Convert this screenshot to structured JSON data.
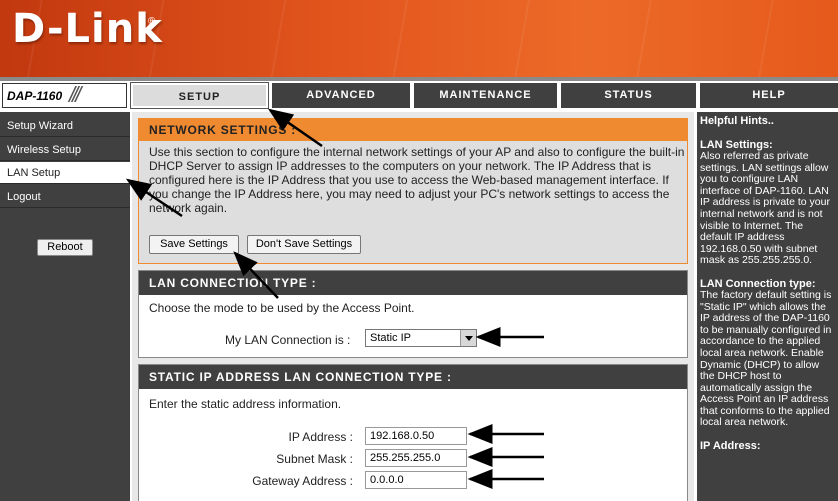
{
  "brand": {
    "logo": "D-Link",
    "registered": "®"
  },
  "model": {
    "label": "DAP-1160",
    "slashes": "///"
  },
  "tabs": [
    {
      "label": "SETUP",
      "active": true
    },
    {
      "label": "ADVANCED",
      "active": false
    },
    {
      "label": "MAINTENANCE",
      "active": false
    },
    {
      "label": "STATUS",
      "active": false
    },
    {
      "label": "HELP",
      "active": false
    }
  ],
  "sidebar": {
    "items": [
      {
        "label": "Setup Wizard",
        "active": false
      },
      {
        "label": "Wireless Setup",
        "active": false
      },
      {
        "label": "LAN Setup",
        "active": true
      },
      {
        "label": "Logout",
        "active": false
      }
    ],
    "reboot_label": "Reboot"
  },
  "network_settings": {
    "title": "NETWORK SETTINGS :",
    "description": "Use this section to configure the internal network settings of your AP and also to configure the built-in DHCP Server to assign IP addresses to the computers on your network. The IP Address that is configured here is the IP Address that you use to access the Web-based management interface. If you change the IP Address here, you may need to adjust your PC's network settings to access the network again.",
    "save_label": "Save Settings",
    "dont_save_label": "Don't Save Settings"
  },
  "lan_connection": {
    "title": "LAN CONNECTION TYPE :",
    "description": "Choose the mode to be used by the Access Point.",
    "field_label": "My LAN Connection is :",
    "selected": "Static IP"
  },
  "static_ip": {
    "title": "STATIC IP ADDRESS LAN CONNECTION TYPE :",
    "description": "Enter the static address information.",
    "fields": [
      {
        "label": "IP Address :",
        "value": "192.168.0.50"
      },
      {
        "label": "Subnet Mask :",
        "value": "255.255.255.0"
      },
      {
        "label": "Gateway Address :",
        "value": "0.0.0.0"
      }
    ]
  },
  "hints": {
    "title": "Helpful Hints..",
    "sections": [
      {
        "heading": "LAN Settings:",
        "text": "Also referred as private settings. LAN settings allow you to configure LAN interface of DAP-1160. LAN IP address is private to your internal network and is not visible to Internet. The default IP address 192.168.0.50 with subnet mask as 255.255.255.0."
      },
      {
        "heading": "LAN Connection type:",
        "text": "The factory default setting is \"Static IP\" which allows the IP address of the DAP-1160 to be manually configured in accordance to the applied local area network. Enable Dynamic (DHCP) to allow the DHCP host to automatically assign the Access Point an IP address that conforms to the applied local area network."
      },
      {
        "heading": "IP Address:",
        "text": ""
      }
    ]
  },
  "colors": {
    "accent": "#f08a30",
    "dark": "#404040",
    "header": "#e2551d"
  }
}
